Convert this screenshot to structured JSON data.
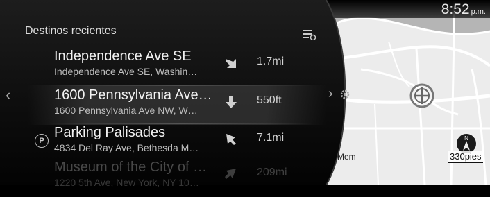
{
  "status": {
    "time": "8:52",
    "ampm": "p.m."
  },
  "panel": {
    "title": "Destinos recientes"
  },
  "destinations": [
    {
      "name": "Independence Ave SE",
      "address": "Independence Ave SE, Washin…",
      "distance": "1.7mi",
      "direction": "down-right"
    },
    {
      "name": "1600 Pennsylvania Ave…",
      "address": "1600 Pennsylvania Ave NW, W…",
      "distance": "550ft",
      "direction": "down"
    },
    {
      "name": "Parking Palisades",
      "address": "4834 Del Ray Ave, Bethesda M…",
      "distance": "7.1mi",
      "direction": "up-left",
      "poi_icon": "P"
    },
    {
      "name": "Museum of the City of …",
      "address": "1220 5th Ave, New York, NY 10…",
      "distance": "209mi",
      "direction": "up-right"
    }
  ],
  "map": {
    "scale": "330pies",
    "label": "Mem",
    "compass": "N"
  },
  "icons": {
    "list_options": "list-options-icon",
    "prev": "chevron-left-icon",
    "next": "chevron-right-icon",
    "settings": "gear-icon",
    "compass": "compass-icon",
    "position": "vehicle-position-icon"
  }
}
